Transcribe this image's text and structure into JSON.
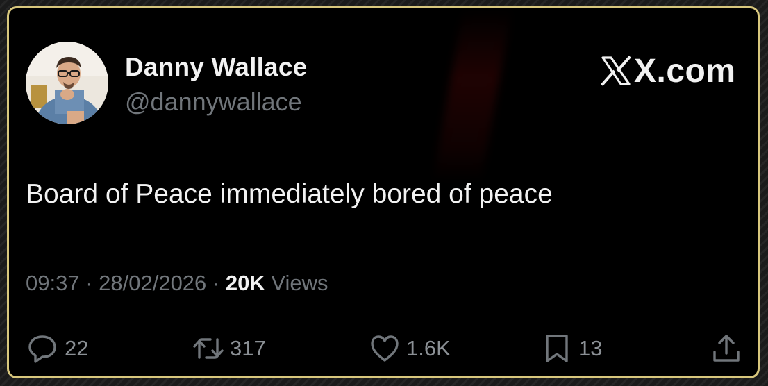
{
  "author": {
    "name": "Danny Wallace",
    "handle": "@dannywallace"
  },
  "brand": {
    "label": "X.com"
  },
  "tweet": {
    "text": "Board of Peace immediately bored of peace"
  },
  "meta": {
    "time": "09:37",
    "separator": " · ",
    "date": "28/02/2026",
    "views_count": "20K",
    "views_label": "Views"
  },
  "actions": {
    "replies": "22",
    "reposts": "317",
    "likes": "1.6K",
    "bookmarks": "13"
  },
  "colors": {
    "card_border": "#d8c77d",
    "background": "#000000",
    "primary_text": "#f2f2f2",
    "secondary_text": "#71767b"
  },
  "icons": [
    "reply-icon",
    "repost-icon",
    "like-icon",
    "bookmark-icon",
    "share-icon",
    "x-logo-icon"
  ]
}
